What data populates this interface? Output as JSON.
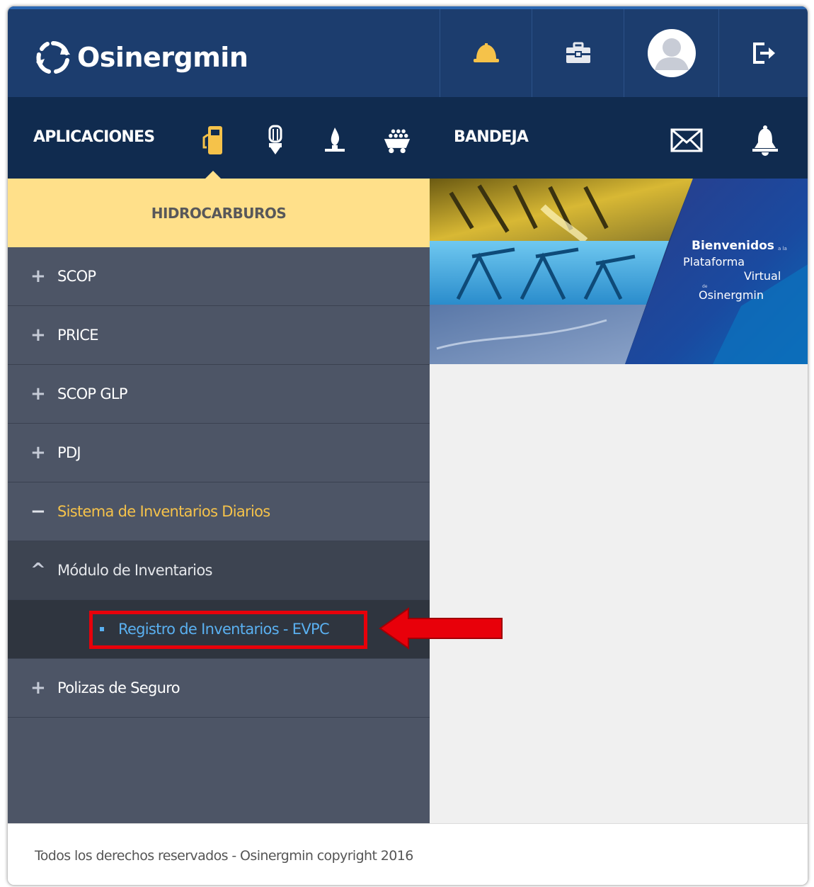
{
  "header": {
    "brand": "Osinergmin",
    "icons": [
      "hard-hat-icon",
      "briefcase-icon",
      "avatar",
      "logout-icon"
    ]
  },
  "apps": {
    "title": "APLICACIONES",
    "icons": [
      "fuel-pump-icon",
      "light-bulb-icon",
      "gas-flame-icon",
      "mining-cart-icon"
    ]
  },
  "inbox": {
    "title": "BANDEJA",
    "icons": [
      "mail-icon",
      "bell-icon"
    ]
  },
  "sidebar": {
    "section_title": "HIDROCARBUROS",
    "items": [
      {
        "symbol": "+",
        "label": "SCOP"
      },
      {
        "symbol": "+",
        "label": "PRICE"
      },
      {
        "symbol": "+",
        "label": "SCOP GLP"
      },
      {
        "symbol": "+",
        "label": "PDJ"
      },
      {
        "symbol": "−",
        "label": "Sistema de Inventarios Diarios"
      },
      {
        "symbol": "^",
        "label": "Módulo de Inventarios"
      },
      {
        "label": "Registro de Inventarios - EVPC"
      },
      {
        "symbol": "+",
        "label": "Polizas de Seguro"
      }
    ]
  },
  "banner": {
    "line1": "Bienvenidos",
    "line1_small": "a la",
    "line2": "Plataforma",
    "line3": "Virtual",
    "line3_small": "de",
    "line4": "Osinergmin"
  },
  "footer": {
    "text": "Todos los derechos reservados - Osinergmin copyright 2016"
  },
  "colors": {
    "header_bg": "#1c3d6e",
    "subheader_bg": "#102b4f",
    "section_header_bg": "#ffe08a",
    "sidebar_bg": "#4d5566",
    "active_label": "#f5c24a",
    "link_blue": "#5ab0f0",
    "highlight_red": "#e8000a"
  }
}
